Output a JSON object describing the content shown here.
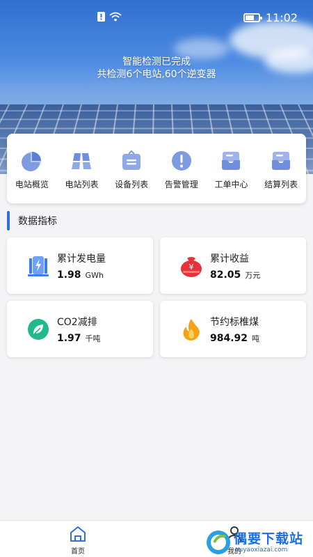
{
  "status_bar": {
    "time": "11:02"
  },
  "hero": {
    "line1": "智能检测已完成",
    "line2": "共检测6个电站,60个逆变器"
  },
  "features": [
    {
      "label": "电站概览",
      "icon": "pie-chart-icon"
    },
    {
      "label": "电站列表",
      "icon": "solar-panel-icon"
    },
    {
      "label": "设备列表",
      "icon": "device-box-icon"
    },
    {
      "label": "告警管理",
      "icon": "alert-icon"
    },
    {
      "label": "工单中心",
      "icon": "work-order-icon"
    },
    {
      "label": "结算列表",
      "icon": "settlement-icon"
    }
  ],
  "section": {
    "title": "数据指标"
  },
  "stats": [
    {
      "label": "累计发电量",
      "value": "1.98",
      "unit": "GWh",
      "icon": "power-generation-icon"
    },
    {
      "label": "累计收益",
      "value": "82.05",
      "unit": "万元",
      "icon": "money-bag-icon"
    },
    {
      "label": "CO2减排",
      "value": "1.97",
      "unit": "千吨",
      "icon": "leaf-icon"
    },
    {
      "label": "节约标椎煤",
      "value": "984.92",
      "unit": "吨",
      "icon": "flame-icon"
    }
  ],
  "bottom_nav": {
    "home": "首页",
    "mine": "我的"
  },
  "watermark": {
    "title": "偶要下载站",
    "url": "ouyaoxiazai.com"
  },
  "colors": {
    "accent": "#2f6fe0",
    "icon_blue": "#5b7fd6",
    "money_red": "#e8323a",
    "leaf_green": "#1fb98b",
    "flame_orange": "#f6a219"
  }
}
